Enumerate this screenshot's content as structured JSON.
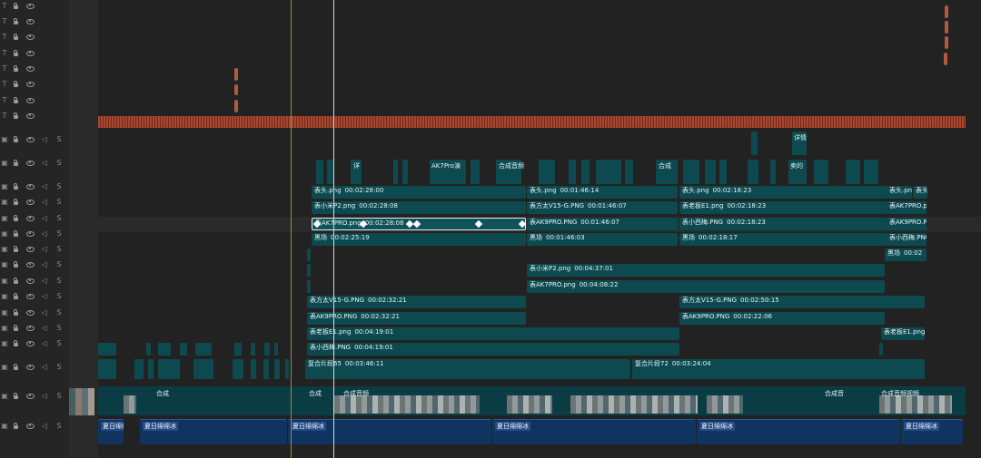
{
  "video_tracks": [
    {
      "clips": [
        {
          "name": "",
          "tc": ""
        },
        {
          "name": "",
          "tc": ""
        }
      ]
    }
  ],
  "row_212": [
    {
      "name": "表头.png",
      "tc": "00:02:28:00"
    },
    {
      "name": "表头.png",
      "tc": "00:01:46:14"
    },
    {
      "name": "表头.png",
      "tc": "00:02:18:23"
    },
    {
      "name": "表头.png",
      "tc": ""
    },
    {
      "name": "表头",
      "tc": ""
    }
  ],
  "row_229": [
    {
      "name": "表小米P2.png",
      "tc": "00:02:28:08"
    },
    {
      "name": "表方太V15-G.PNG",
      "tc": "00:01:46:07"
    },
    {
      "name": "表老板E1.png",
      "tc": "00:02:18:23"
    },
    {
      "name": "表AK7PRO.png",
      "tc": ""
    }
  ],
  "row_247": [
    {
      "name": "表AK7PRO.png",
      "tc": "00:02:28:08"
    },
    {
      "name": "表AK9PRO.PNG",
      "tc": "00:01:46:07"
    },
    {
      "name": "表小西梅.PNG",
      "tc": "00:02:18:23"
    },
    {
      "name": "表AK9PRO.P",
      "tc": ""
    }
  ],
  "row_264": [
    {
      "name": "黑场",
      "tc": "00:02:25:19"
    },
    {
      "name": "黑场",
      "tc": "00:01:46:03"
    },
    {
      "name": "黑场",
      "tc": "00:02:18:17"
    },
    {
      "name": "表小西梅.PNG",
      "tc": ""
    }
  ],
  "row_281": [
    {
      "name": "黑场",
      "tc": "00:02"
    }
  ],
  "row_298": [
    {
      "name": "表小米P2.png",
      "tc": "00:04:37:01"
    }
  ],
  "row_316": [
    {
      "name": "表AK7PRO.png",
      "tc": "00:04:08:22"
    }
  ],
  "row_333": [
    {
      "name": "表方太V15-G.PNG",
      "tc": "00:02:32:21"
    },
    {
      "name": "表方太V15-G.PNG",
      "tc": "00:02:50:15"
    }
  ],
  "row_351": [
    {
      "name": "表AK9PRO.PNG",
      "tc": "00:02:32:21"
    },
    {
      "name": "表AK9PRO.PNG",
      "tc": "00:02:22:06"
    }
  ],
  "row_368": [
    {
      "name": "表老板E1.png",
      "tc": "00:04:19:01"
    },
    {
      "name": "表老板E1.png",
      "tc": ""
    }
  ],
  "row_385": [
    {
      "name": "表小西梅.PNG",
      "tc": "00:04:19:01"
    }
  ],
  "row_403": [
    {
      "name": "复合片段65",
      "tc": "00:03:46:11"
    },
    {
      "name": "复合片段72",
      "tc": "00:03:24:04"
    }
  ],
  "small_labels": {
    "ak7": "AK7Pro演",
    "heji1": "合成音频",
    "heji2": "合成",
    "xiang": "详",
    "he": "合",
    "huang": "黄场",
    "fu": "复",
    "xiangqing": "详情",
    "mai": "卖的",
    "hecheng": "合成",
    "hecheng_yp": "合成音频",
    "yinpin": "合成音频视频",
    "heji3": "合成音"
  },
  "audio_clips": [
    {
      "name": "夏日绵绵冰"
    },
    {
      "name": "夏日绵绵冰"
    },
    {
      "name": "夏日绵绵冰"
    },
    {
      "name": "夏日绵绵冰"
    },
    {
      "name": "夏日绵绵冰"
    },
    {
      "name": "夏日绵绵冰"
    }
  ],
  "header_solo_label": "S",
  "colors": {
    "clip": "#0c4a50",
    "audio": "#0f3460",
    "playhead": "#d8d8d8",
    "in_point": "#a6873a",
    "marker": "#b05a3e"
  }
}
